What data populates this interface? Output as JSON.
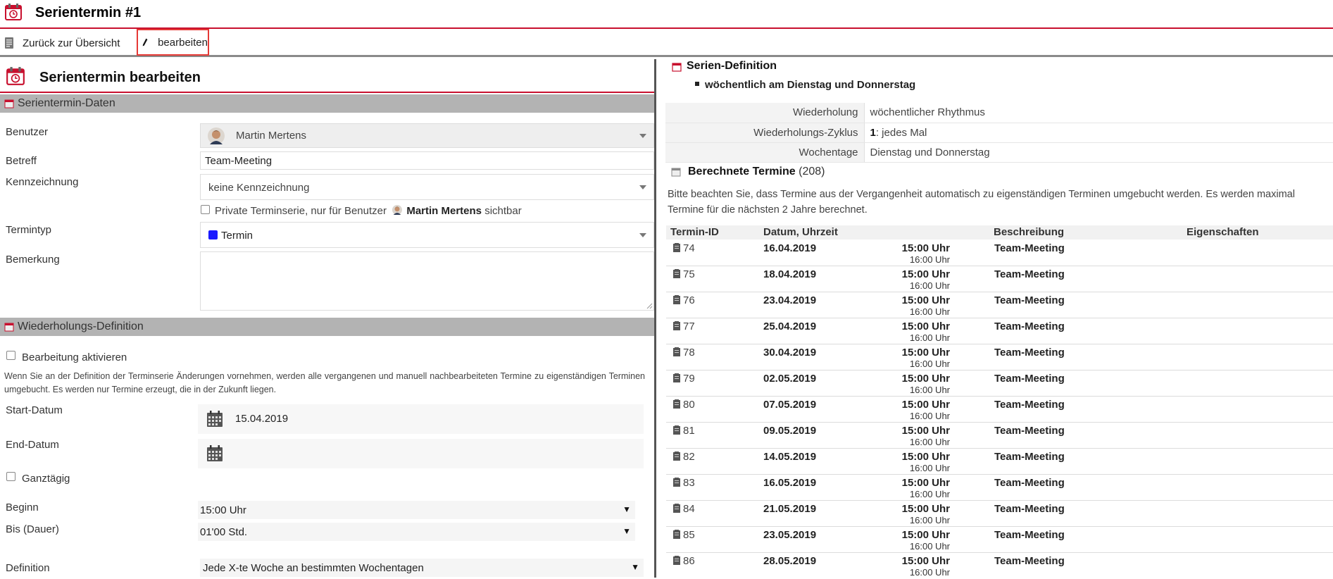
{
  "window": {
    "title": "Serientermin #1"
  },
  "toolbar": {
    "back_label": "Zurück zur Übersicht",
    "edit_label": "bearbeiten"
  },
  "editor": {
    "title": "Serientermin bearbeiten",
    "section_data": "Serientermin-Daten",
    "labels": {
      "user": "Benutzer",
      "subject": "Betreff",
      "marking": "Kennzeichnung",
      "type": "Termintyp",
      "remark": "Bemerkung"
    },
    "values": {
      "user": "Martin Mertens",
      "subject": "Team-Meeting",
      "marking": "keine Kennzeichnung",
      "type": "Termin",
      "remark": ""
    },
    "private": {
      "prefix": "Private Terminserie, nur für Benutzer",
      "user": "Martin Mertens",
      "suffix": "sichtbar"
    },
    "section_repeat": "Wiederholungs-Definition",
    "activate_label": "Bearbeitung aktivieren",
    "note": "Wenn Sie an der Definition der Terminserie Änderungen vornehmen, werden alle vergangenen und manuell nachbearbeiteten Termine zu eigenständigen Terminen umgebucht. Es werden nur Termine erzeugt, die in der Zukunft liegen.",
    "start_label": "Start-Datum",
    "start_value": "15.04.2019",
    "end_label": "End-Datum",
    "end_value": "",
    "allday_label": "Ganztägig",
    "begin_label": "Beginn",
    "begin_value": "15:00 Uhr",
    "duration_label": "Bis (Dauer)",
    "duration_value": "01'00 Std.",
    "definition_label": "Definition",
    "definition_value": "Jede X-te Woche an bestimmten Wochentagen"
  },
  "series": {
    "title": "Serien-Definition",
    "summary": "wöchentlich am Dienstag und Donnerstag",
    "rows": [
      {
        "key": "Wiederholung",
        "value": "wöchentlicher Rhythmus"
      },
      {
        "key": "Wiederholungs-Zyklus",
        "value_bold": "1",
        "value": ": jedes Mal"
      },
      {
        "key": "Wochentage",
        "value": "Dienstag und Donnerstag"
      }
    ]
  },
  "computed": {
    "title": "Berechnete Termine",
    "count": "(208)",
    "note_line1": "Bitte beachten Sie, dass Termine aus der Vergangenheit automatisch zu eigenständigen Terminen umgebucht werden. Es werden maximal",
    "note_line2": "Termine für die nächsten 2 Jahre berechnet.",
    "headers": {
      "id": "Termin-ID",
      "date": "Datum, Uhrzeit",
      "desc": "Beschreibung",
      "props": "Eigenschaften"
    },
    "rows": [
      {
        "id": "74",
        "date": "16.04.2019",
        "start": "15:00 Uhr",
        "end": "16:00 Uhr",
        "desc": "Team-Meeting"
      },
      {
        "id": "75",
        "date": "18.04.2019",
        "start": "15:00 Uhr",
        "end": "16:00 Uhr",
        "desc": "Team-Meeting"
      },
      {
        "id": "76",
        "date": "23.04.2019",
        "start": "15:00 Uhr",
        "end": "16:00 Uhr",
        "desc": "Team-Meeting"
      },
      {
        "id": "77",
        "date": "25.04.2019",
        "start": "15:00 Uhr",
        "end": "16:00 Uhr",
        "desc": "Team-Meeting"
      },
      {
        "id": "78",
        "date": "30.04.2019",
        "start": "15:00 Uhr",
        "end": "16:00 Uhr",
        "desc": "Team-Meeting"
      },
      {
        "id": "79",
        "date": "02.05.2019",
        "start": "15:00 Uhr",
        "end": "16:00 Uhr",
        "desc": "Team-Meeting"
      },
      {
        "id": "80",
        "date": "07.05.2019",
        "start": "15:00 Uhr",
        "end": "16:00 Uhr",
        "desc": "Team-Meeting"
      },
      {
        "id": "81",
        "date": "09.05.2019",
        "start": "15:00 Uhr",
        "end": "16:00 Uhr",
        "desc": "Team-Meeting"
      },
      {
        "id": "82",
        "date": "14.05.2019",
        "start": "15:00 Uhr",
        "end": "16:00 Uhr",
        "desc": "Team-Meeting"
      },
      {
        "id": "83",
        "date": "16.05.2019",
        "start": "15:00 Uhr",
        "end": "16:00 Uhr",
        "desc": "Team-Meeting"
      },
      {
        "id": "84",
        "date": "21.05.2019",
        "start": "15:00 Uhr",
        "end": "16:00 Uhr",
        "desc": "Team-Meeting"
      },
      {
        "id": "85",
        "date": "23.05.2019",
        "start": "15:00 Uhr",
        "end": "16:00 Uhr",
        "desc": "Team-Meeting"
      },
      {
        "id": "86",
        "date": "28.05.2019",
        "start": "15:00 Uhr",
        "end": "16:00 Uhr",
        "desc": "Team-Meeting"
      }
    ]
  },
  "colors": {
    "accent": "#c8102e",
    "highlight": "#e53935",
    "section_bg": "#b3b3b3",
    "type_color": "#1a1aff"
  },
  "icons": {
    "calendar": "calendar-clock-icon",
    "back": "document-icon",
    "edit": "pencil-icon",
    "date": "calendar-icon",
    "row": "document-icon"
  }
}
